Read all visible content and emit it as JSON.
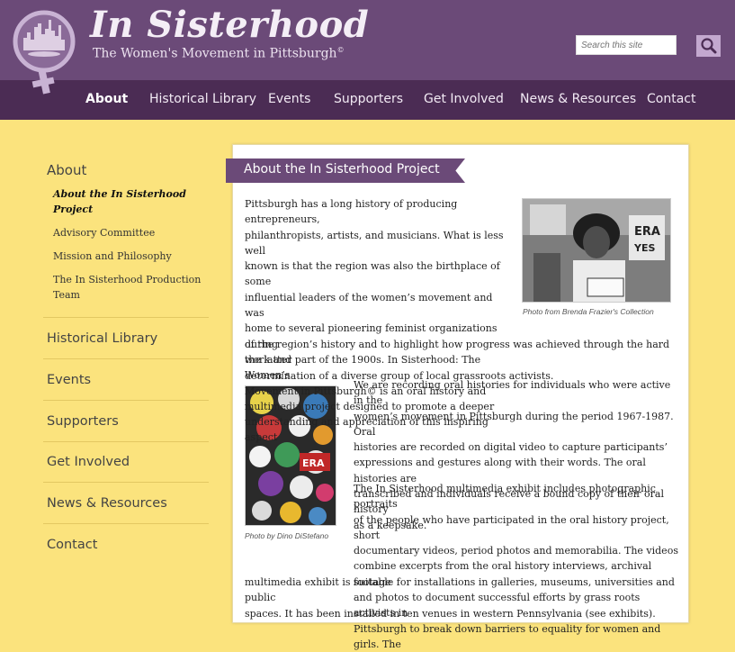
{
  "site": {
    "title": "In Sisterhood",
    "subtitle": "The Women's Movement in Pittsburgh",
    "subtitle_mark": "©"
  },
  "search": {
    "placeholder": "Search this site",
    "button_icon": "magnifier-icon"
  },
  "nav": {
    "items": [
      "About",
      "Historical Library",
      "Events",
      "Supporters",
      "Get Involved",
      "News & Resources",
      "Contact"
    ],
    "active": "About"
  },
  "sidebar": {
    "heading": "About",
    "sub_items": [
      {
        "label": "About the In Sisterhood",
        "label2": "Project",
        "current": true
      },
      {
        "label": "Advisory Committee"
      },
      {
        "label": "Mission and Philosophy"
      },
      {
        "label": "The In Sisterhood Production",
        "label2": "Team"
      }
    ],
    "main_items": [
      "Historical Library",
      "Events",
      "Supporters",
      "Get Involved",
      "News & Resources",
      "Contact"
    ]
  },
  "content": {
    "heading": "About the In Sisterhood Project",
    "p1_lines": [
      "Pittsburgh has a long history of producing entrepreneurs,",
      "philanthropists, artists, and musicians. What is less well",
      "known is that the region was also the birthplace of some",
      "influential leaders of the women’s movement and was",
      "home to several pioneering feminist organizations during",
      "the latter part of the 1900s. In Sisterhood: The Women’s",
      "Movement in Pittsburgh© is an oral history and",
      "multimedia project designed to promote a deeper",
      "understanding and appreciation of this inspiring aspect",
      "of the region’s history and to highlight how progress was achieved through the hard work and",
      "determination of a diverse group of local grassroots activists."
    ],
    "p2_lines": [
      "We are recording oral histories for individuals who were active in the",
      "women’s movement in Pittsburgh during the period 1967-1987. Oral",
      "histories are recorded on digital video to capture participants’",
      "expressions and gestures along with their words. The oral histories are",
      "transcribed and individuals receive a bound copy of their oral history",
      "as a keepsake."
    ],
    "p3_lines": [
      "The In Sisterhood multimedia exhibit includes photographic portraits",
      "of the people who have participated in the oral history project, short",
      "documentary videos, period photos and memorabilia. The videos",
      "combine excerpts from the oral history interviews, archival footage",
      "and photos to document successful efforts by grass roots activists in",
      "Pittsburgh to break down barriers to equality for women and girls. The",
      "multimedia exhibit is suitable for installations in galleries, museums, universities and public",
      "spaces. It has been installed in ten venues in western Pennsylvania (see exhibits)."
    ],
    "photo1_caption": "Photo from Brenda Frazier's Collection",
    "photo2_caption": "Photo by Dino DiStefano"
  },
  "colors": {
    "header": "#6b4a78",
    "nav": "#4b2c54",
    "background": "#fbe37d",
    "accent": "#c3a8cf"
  }
}
